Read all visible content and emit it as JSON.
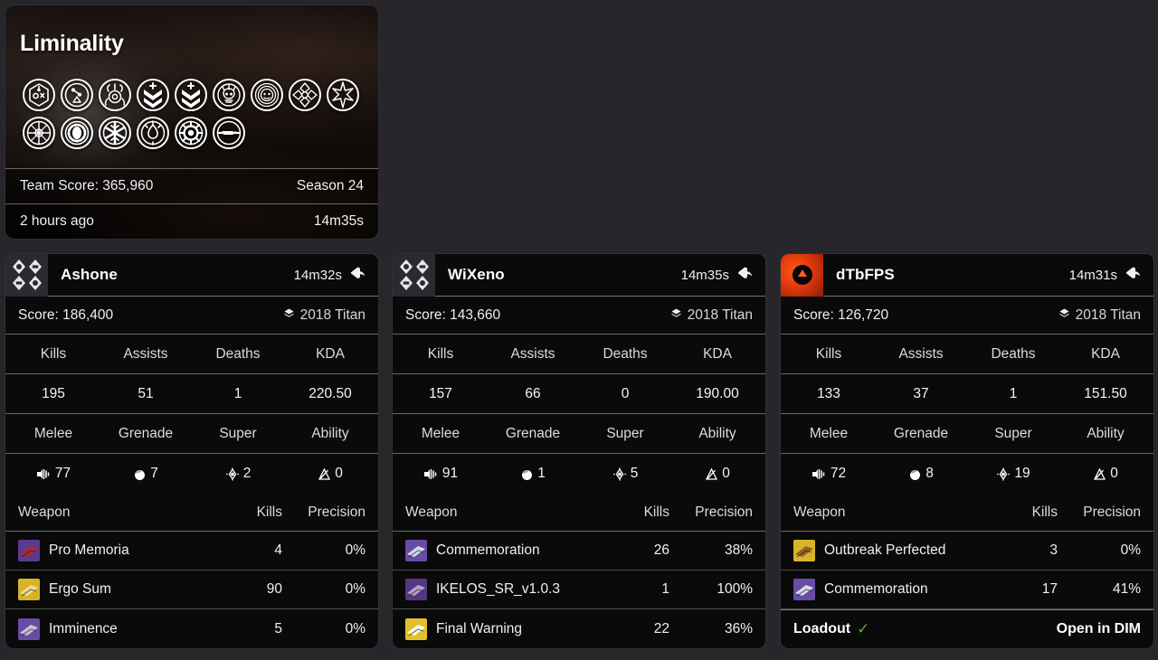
{
  "activity": {
    "title": "Liminality",
    "team_score_label": "Team Score: 365,960",
    "season_label": "Season 24",
    "time_ago": "2 hours ago",
    "duration": "14m35s",
    "modifiers": [
      "hexagon-chemical-icon",
      "percent-triangle-icon",
      "arc-conduction-icon",
      "chevron-down-plus-icon",
      "chevron-down-plus-2-icon",
      "crowned-skull-icon",
      "radial-face-icon",
      "compass-burst-icon",
      "starburst-spikes-icon",
      "wheel-cross-icon",
      "radiant-orb-icon",
      "snowflake-burst-icon",
      "flame-shield-icon",
      "gear-ring-icon",
      "scope-rifle-icon"
    ]
  },
  "players": [
    {
      "name": "Ashone",
      "emblem_icon": "diamond-quad-emblem",
      "emblem_style": "dark",
      "duration": "14m32s",
      "share_icon": "layers-icon",
      "score_label": "Score: 186,400",
      "class_icon": "titan-mark-icon",
      "class_label": "2018 Titan",
      "stat_headers": [
        "Kills",
        "Assists",
        "Deaths",
        "KDA"
      ],
      "stat_values": [
        "195",
        "51",
        "1",
        "220.50"
      ],
      "ability_headers": [
        "Melee",
        "Grenade",
        "Super",
        "Ability"
      ],
      "ability_values": [
        "77",
        "7",
        "2",
        "0"
      ],
      "ability_icons": [
        "melee-icon",
        "grenade-icon",
        "super-icon",
        "ability-icon"
      ],
      "weapon_headers": [
        "Weapon",
        "Kills",
        "Precision"
      ],
      "weapons": [
        {
          "name": "Pro Memoria",
          "kills": "4",
          "precision": "0%",
          "thumb": "purple-red"
        },
        {
          "name": "Ergo Sum",
          "kills": "90",
          "precision": "0%",
          "thumb": "gold-sword"
        },
        {
          "name": "Imminence",
          "kills": "5",
          "precision": "0%",
          "thumb": "purple-smg"
        }
      ],
      "loadout": null
    },
    {
      "name": "WiXeno",
      "emblem_icon": "diamond-quad-emblem",
      "emblem_style": "dark",
      "duration": "14m35s",
      "share_icon": "layers-icon",
      "score_label": "Score: 143,660",
      "class_icon": "titan-mark-icon",
      "class_label": "2018 Titan",
      "stat_headers": [
        "Kills",
        "Assists",
        "Deaths",
        "KDA"
      ],
      "stat_values": [
        "157",
        "66",
        "0",
        "190.00"
      ],
      "ability_headers": [
        "Melee",
        "Grenade",
        "Super",
        "Ability"
      ],
      "ability_values": [
        "91",
        "1",
        "5",
        "0"
      ],
      "ability_icons": [
        "melee-icon",
        "grenade-icon",
        "super-icon",
        "ability-icon"
      ],
      "weapon_headers": [
        "Weapon",
        "Kills",
        "Precision"
      ],
      "weapons": [
        {
          "name": "Commemoration",
          "kills": "26",
          "precision": "38%",
          "thumb": "purple-mg"
        },
        {
          "name": "IKELOS_SR_v1.0.3",
          "kills": "1",
          "precision": "100%",
          "thumb": "purple-sniper"
        },
        {
          "name": "Final Warning",
          "kills": "22",
          "precision": "36%",
          "thumb": "gold-sidearm"
        }
      ],
      "loadout": null
    },
    {
      "name": "dTbFPS",
      "emblem_icon": "triangle-circle-emblem",
      "emblem_style": "red",
      "duration": "14m31s",
      "share_icon": "layers-icon",
      "score_label": "Score: 126,720",
      "class_icon": "titan-mark-icon",
      "class_label": "2018 Titan",
      "stat_headers": [
        "Kills",
        "Assists",
        "Deaths",
        "KDA"
      ],
      "stat_values": [
        "133",
        "37",
        "1",
        "151.50"
      ],
      "ability_headers": [
        "Melee",
        "Grenade",
        "Super",
        "Ability"
      ],
      "ability_values": [
        "72",
        "8",
        "19",
        "0"
      ],
      "ability_icons": [
        "melee-icon",
        "grenade-icon",
        "super-icon",
        "ability-icon"
      ],
      "weapon_headers": [
        "Weapon",
        "Kills",
        "Precision"
      ],
      "weapons": [
        {
          "name": "Outbreak Perfected",
          "kills": "3",
          "precision": "0%",
          "thumb": "gold-pulse"
        },
        {
          "name": "Commemoration",
          "kills": "17",
          "precision": "41%",
          "thumb": "purple-mg"
        }
      ],
      "loadout": {
        "label": "Loadout",
        "check": "✓",
        "open_label": "Open in DIM"
      }
    }
  ],
  "colors": {
    "page_bg": "#26262b",
    "card_bg": "#0a0a0a",
    "accent_check": "#56b040",
    "emblem_red": "#e03a0c"
  }
}
